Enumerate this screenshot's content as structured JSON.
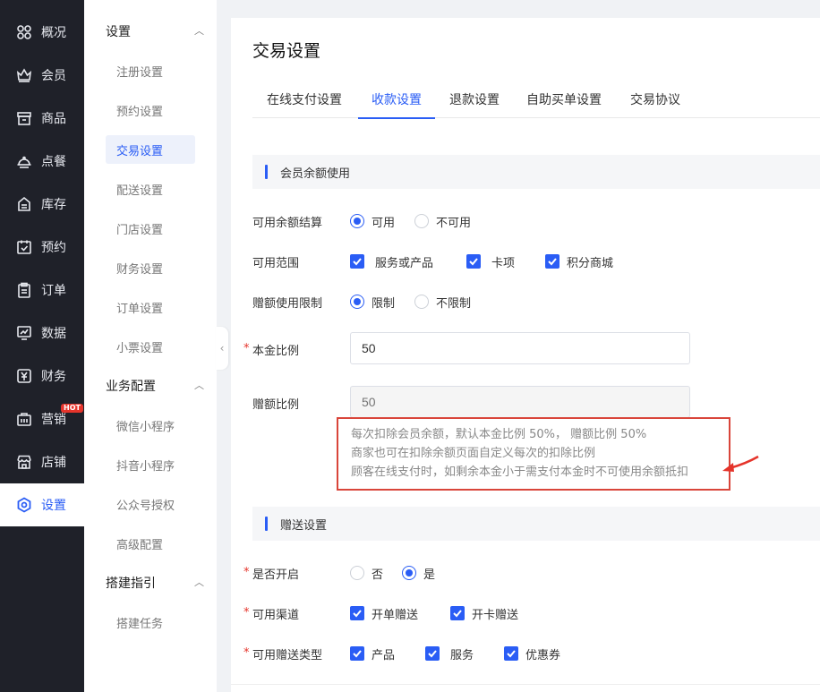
{
  "rail": {
    "items": [
      {
        "label": "概况",
        "icon": "grid-icon"
      },
      {
        "label": "会员",
        "icon": "crown-icon"
      },
      {
        "label": "商品",
        "icon": "shop-icon"
      },
      {
        "label": "点餐",
        "icon": "cloche-icon"
      },
      {
        "label": "库存",
        "icon": "inventory-icon"
      },
      {
        "label": "预约",
        "icon": "calendar-check-icon"
      },
      {
        "label": "订单",
        "icon": "clipboard-icon"
      },
      {
        "label": "数据",
        "icon": "chart-monitor-icon"
      },
      {
        "label": "财务",
        "icon": "yen-icon"
      },
      {
        "label": "营销",
        "icon": "bag-icon",
        "badge": "HOT"
      },
      {
        "label": "店铺",
        "icon": "store-icon"
      },
      {
        "label": "设置",
        "icon": "hexagon-settings-icon",
        "active": true
      }
    ]
  },
  "subnav": {
    "groups": [
      {
        "title": "设置",
        "items": [
          "注册设置",
          "预约设置",
          "交易设置",
          "配送设置",
          "门店设置",
          "财务设置",
          "订单设置",
          "小票设置"
        ],
        "active": "交易设置"
      },
      {
        "title": "业务配置",
        "items": [
          "微信小程序",
          "抖音小程序",
          "公众号授权",
          "高级配置"
        ]
      },
      {
        "title": "搭建指引",
        "items": [
          "搭建任务"
        ]
      }
    ]
  },
  "page": {
    "title": "交易设置",
    "tabs": [
      "在线支付设置",
      "收款设置",
      "退款设置",
      "自助买单设置",
      "交易协议"
    ],
    "active_tab": "收款设置"
  },
  "balance_section": {
    "title": "会员余额使用",
    "settle": {
      "label": "可用余额结算",
      "options": [
        "可用",
        "不可用"
      ],
      "selected": "可用"
    },
    "scope": {
      "label": "可用范围",
      "options": [
        "服务或产品",
        "卡项",
        "积分商城"
      ],
      "checked": [
        "服务或产品",
        "卡项",
        "积分商城"
      ]
    },
    "gift_limit": {
      "label": "赠额使用限制",
      "options": [
        "限制",
        "不限制"
      ],
      "selected": "限制"
    },
    "principal_ratio": {
      "label": "本金比例",
      "value": "50"
    },
    "gift_ratio": {
      "label": "赠额比例",
      "placeholder": "50"
    },
    "notes": [
      "每次扣除会员余额，默认本金比例 50%， 赠额比例 50%",
      "商家也可在扣除余额页面自定义每次的扣除比例",
      "顾客在线支付时，如剩余本金小于需支付本金时不可使用余额抵扣"
    ]
  },
  "gift_section": {
    "title": "赠送设置",
    "enabled": {
      "label": "是否开启",
      "options": [
        "否",
        "是"
      ],
      "selected": "是"
    },
    "channels": {
      "label": "可用渠道",
      "options": [
        "开单赠送",
        "开卡赠送"
      ]
    },
    "types": {
      "label": "可用赠送类型",
      "options": [
        "产品",
        "服务",
        "优惠券"
      ]
    }
  },
  "colors": {
    "accent": "#2a5df5",
    "rail_bg": "#1f2129",
    "required": "#e5342b",
    "annotation": "#d9453a"
  }
}
